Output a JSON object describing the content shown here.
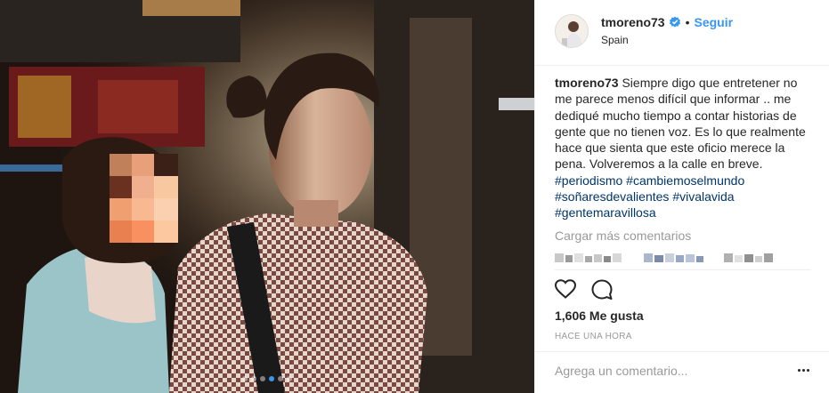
{
  "post": {
    "username": "tmoreno73",
    "follow_label": "Seguir",
    "separator": "•",
    "location": "Spain",
    "caption_user": "tmoreno73",
    "caption_text": " Siempre digo que entretener no me parece menos difícil que informar .. me dediqué mucho tiempo a contar historias de gente que no tienen voz. Es lo que realmente hace que sienta que este oficio merece la pena. Volveremos a la calle en breve. ",
    "hashtags": [
      "#periodismo",
      "#cambiemoselmundo",
      "#soñaresdevalientes",
      "#vivalavida",
      "#gentemaravillosa"
    ],
    "load_more": "Cargar más comentarios",
    "likes": "1,606 Me gusta",
    "time": "HACE UNA HORA",
    "add_comment_placeholder": "Agrega un comentario..."
  },
  "carousel": {
    "count": 6,
    "active_index": 3
  },
  "colors": {
    "link_blue": "#3897f0",
    "hashtag": "#003569",
    "muted": "#999999",
    "text": "#262626",
    "border": "#efefef"
  },
  "icons": {
    "verified": "verified-badge-icon",
    "like": "heart-icon",
    "comment": "comment-bubble-icon",
    "more": "more-options-icon"
  }
}
